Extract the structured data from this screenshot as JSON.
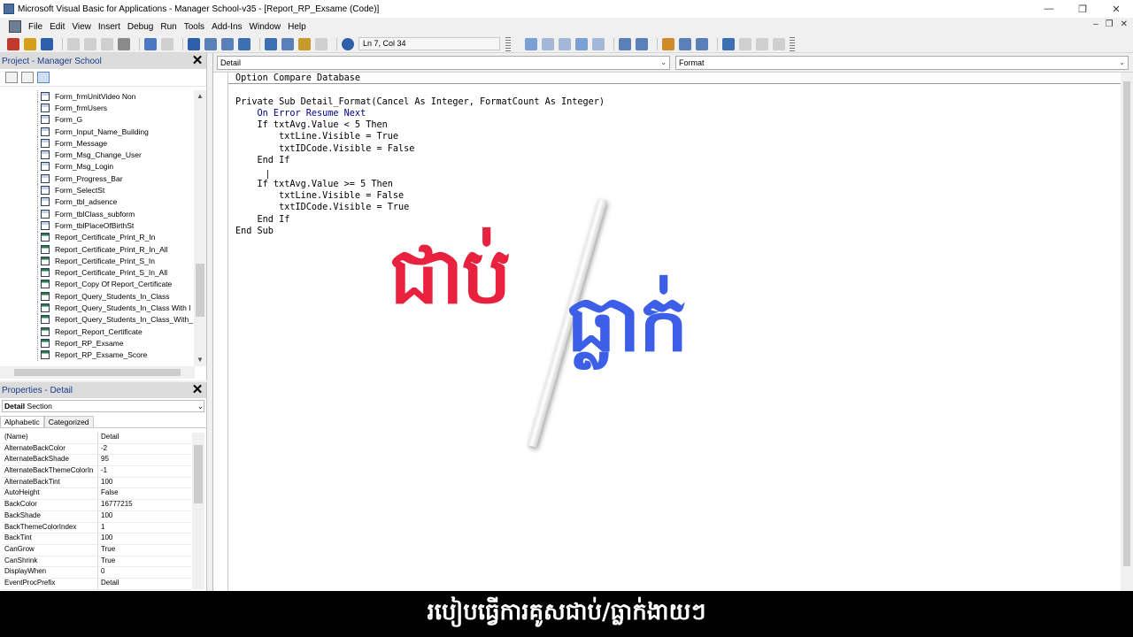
{
  "window": {
    "title": "Microsoft Visual Basic for Applications - Manager School-v35 - [Report_RP_Exsame (Code)]",
    "minimize": "—",
    "restore": "❐",
    "close": "✕"
  },
  "menu": {
    "items": [
      "File",
      "Edit",
      "View",
      "Insert",
      "Debug",
      "Run",
      "Tools",
      "Add-Ins",
      "Window",
      "Help"
    ],
    "right_controls": [
      "–",
      "❐",
      "✕"
    ]
  },
  "toolbar": {
    "cursor_position": "Ln 7, Col 34"
  },
  "project": {
    "title": "Project - Manager School",
    "close": "✕",
    "items": [
      {
        "label": "Form_frmUnitVideo Non",
        "kind": "form"
      },
      {
        "label": "Form_frmUsers",
        "kind": "form"
      },
      {
        "label": "Form_G",
        "kind": "form"
      },
      {
        "label": "Form_Input_Name_Building",
        "kind": "form"
      },
      {
        "label": "Form_Message",
        "kind": "form"
      },
      {
        "label": "Form_Msg_Change_User",
        "kind": "form"
      },
      {
        "label": "Form_Msg_Login",
        "kind": "form"
      },
      {
        "label": "Form_Progress_Bar",
        "kind": "form"
      },
      {
        "label": "Form_SelectSt",
        "kind": "form"
      },
      {
        "label": "Form_tbl_adsence",
        "kind": "form"
      },
      {
        "label": "Form_tblClass_subform",
        "kind": "form"
      },
      {
        "label": "Form_tblPlaceOfBirthSt",
        "kind": "form"
      },
      {
        "label": "Report_Certificate_Print_R_In",
        "kind": "report"
      },
      {
        "label": "Report_Certificate_Print_R_In_All",
        "kind": "report"
      },
      {
        "label": "Report_Certificate_Print_S_In",
        "kind": "report"
      },
      {
        "label": "Report_Certificate_Print_S_In_All",
        "kind": "report"
      },
      {
        "label": "Report_Copy Of Report_Certificate",
        "kind": "report"
      },
      {
        "label": "Report_Query_Students_In_Class",
        "kind": "report"
      },
      {
        "label": "Report_Query_Students_In_Class With I",
        "kind": "report"
      },
      {
        "label": "Report_Query_Students_In_Class_With_",
        "kind": "report"
      },
      {
        "label": "Report_Report_Certificate",
        "kind": "report"
      },
      {
        "label": "Report_RP_Exsame",
        "kind": "report"
      },
      {
        "label": "Report_RP_Exsame_Score",
        "kind": "report"
      }
    ]
  },
  "properties": {
    "title": "Properties - Detail",
    "close": "✕",
    "object_name": "Detail",
    "object_type": "Section",
    "tabs": [
      "Alphabetic",
      "Categorized"
    ],
    "rows": [
      {
        "name": "(Name)",
        "value": "Detail"
      },
      {
        "name": "AlternateBackColor",
        "value": "-2"
      },
      {
        "name": "AlternateBackShade",
        "value": "95"
      },
      {
        "name": "AlternateBackThemeColorIn",
        "value": "-1"
      },
      {
        "name": "AlternateBackTint",
        "value": "100"
      },
      {
        "name": "AutoHeight",
        "value": "False"
      },
      {
        "name": "BackColor",
        "value": "16777215"
      },
      {
        "name": "BackShade",
        "value": "100"
      },
      {
        "name": "BackThemeColorIndex",
        "value": "1"
      },
      {
        "name": "BackTint",
        "value": "100"
      },
      {
        "name": "CanGrow",
        "value": "True"
      },
      {
        "name": "CanShrink",
        "value": "True"
      },
      {
        "name": "DisplayWhen",
        "value": "0"
      },
      {
        "name": "EventProcPrefix",
        "value": "Detail"
      }
    ]
  },
  "code": {
    "object_combo": "Detail",
    "procedure_combo": "Format",
    "lines": [
      "Option Compare Database",
      "",
      "Private Sub Detail_Format(Cancel As Integer, FormatCount As Integer)",
      "    On Error Resume Next",
      "    If txtAvg.Value < 5 Then",
      "        txtLine.Visible = True",
      "        txtIDCode.Visible = False",
      "    End If",
      "",
      "    If txtAvg.Value >= 5 Then",
      "        txtLine.Visible = False",
      "        txtIDCode.Visible = True",
      "    End If",
      "End Sub"
    ]
  },
  "overlay": {
    "left_word": "ជាប់",
    "right_word": "ធ្លាក់",
    "left_color": "#e8213f",
    "right_color": "#3d5ee6"
  },
  "subtitle": "របៀបធ្វើការគូសជាប់/ធ្លាក់ងាយៗ"
}
